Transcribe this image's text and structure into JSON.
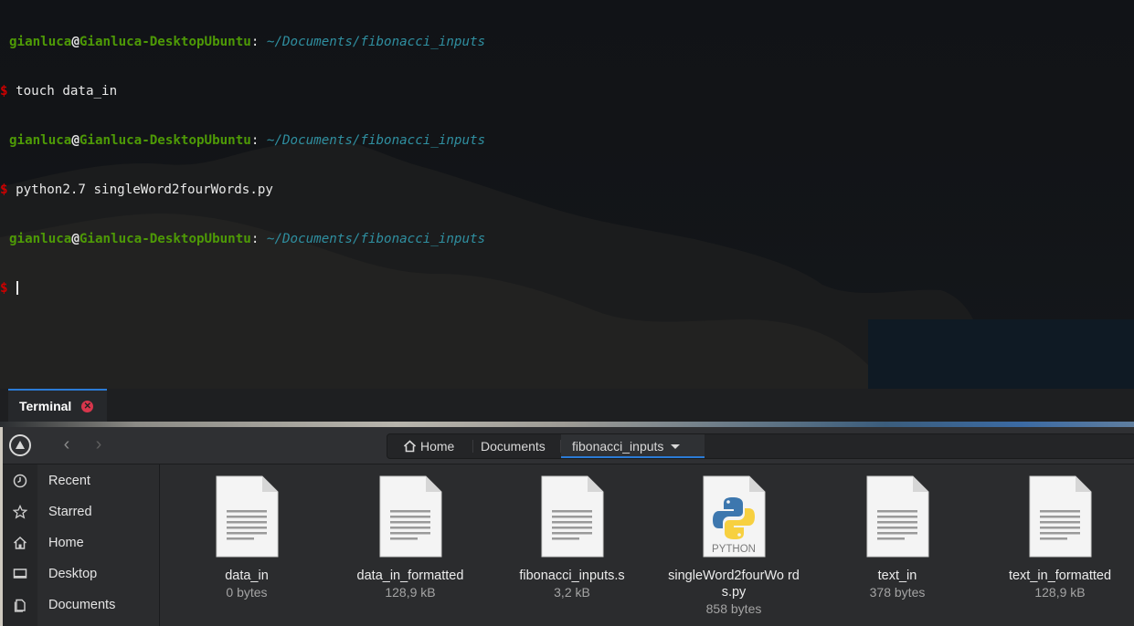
{
  "terminal": {
    "prompt": {
      "user": "gianluca",
      "at": "@",
      "host": "Gianluca-DesktopUbuntu",
      "colon": ":",
      "path": " ~/Documents/fibonacci_inputs",
      "dollar": "$"
    },
    "commands": [
      "touch data_in",
      "python2.7 singleWord2fourWords.py"
    ],
    "tab_label": "Terminal"
  },
  "file_manager": {
    "breadcrumbs": {
      "home": "Home",
      "documents": "Documents",
      "current": "fibonacci_inputs"
    },
    "sidebar": [
      {
        "label": "Recent",
        "icon": "clock-icon"
      },
      {
        "label": "Starred",
        "icon": "star-icon"
      },
      {
        "label": "Home",
        "icon": "home-icon"
      },
      {
        "label": "Desktop",
        "icon": "desktop-icon"
      },
      {
        "label": "Documents",
        "icon": "documents-icon"
      }
    ],
    "files": [
      {
        "name": "data_in",
        "size": "0 bytes",
        "type": "text"
      },
      {
        "name": "data_in_formatted",
        "size": "128,9 kB",
        "type": "text"
      },
      {
        "name": "fibonacci_inputs.s",
        "size": "3,2 kB",
        "type": "text"
      },
      {
        "name": "singleWord2fourWords.py",
        "name_display": "singleWord2fourWo rds.py",
        "size": "858 bytes",
        "type": "python",
        "badge": "PYTHON"
      },
      {
        "name": "text_in",
        "size": "378 bytes",
        "type": "text"
      },
      {
        "name": "text_in_formatted",
        "size": "128,9 kB",
        "type": "text"
      }
    ]
  },
  "colors": {
    "accent": "#2b7bd6",
    "prompt_user": "#4e9a06",
    "prompt_path": "#2f8fa0",
    "prompt_dollar": "#cc0000",
    "close": "#d8364c"
  }
}
